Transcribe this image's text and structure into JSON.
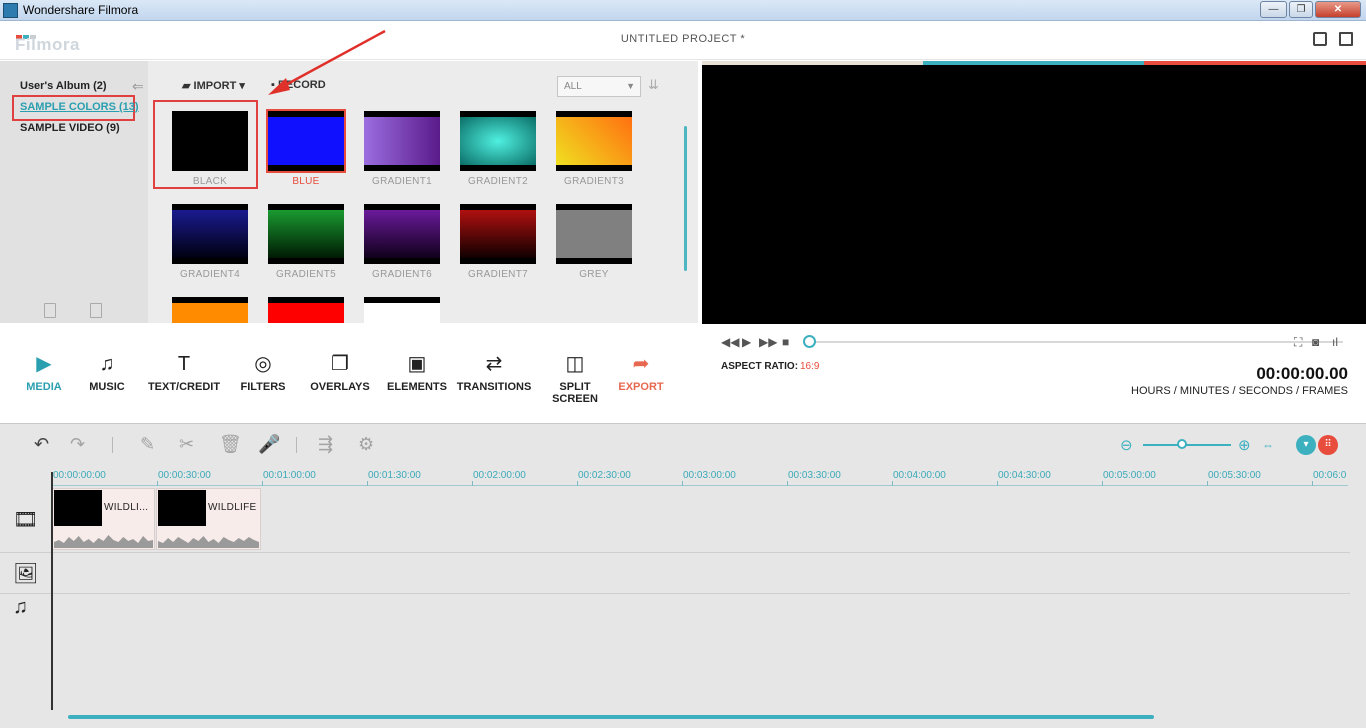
{
  "window": {
    "title": "Wondershare Filmora",
    "minimize": "—",
    "restore": "❐",
    "close": "✕"
  },
  "header": {
    "logo": "Filmora",
    "project_title": "UNTITLED PROJECT *",
    "logo_colors": [
      "#e74c3c",
      "#3db0c0",
      "#c9ced3"
    ]
  },
  "album": {
    "items": [
      {
        "label": "User's Album (2)"
      },
      {
        "label": "SAMPLE COLORS (13)"
      },
      {
        "label": "SAMPLE VIDEO (9)"
      }
    ],
    "back_icon": "left-arrow-icon"
  },
  "library": {
    "import_label": "IMPORT",
    "record_label": "RECORD",
    "filter_value": "ALL",
    "thumbs": [
      {
        "label": "BLACK",
        "color": "#000000"
      },
      {
        "label": "BLUE",
        "color": "#1010ff"
      },
      {
        "label": "GRADIENT1",
        "color": "linear-gradient(90deg,#9b6ee0,#5a1a8a)"
      },
      {
        "label": "GRADIENT2",
        "color": "radial-gradient(ellipse at center,#4ff0e0,#0a6d66)"
      },
      {
        "label": "GRADIENT3",
        "color": "linear-gradient(45deg,#f0e020,#ff7010)"
      },
      {
        "label": "GRADIENT4",
        "color": "linear-gradient(180deg,#1a1a90,#000010)"
      },
      {
        "label": "GRADIENT5",
        "color": "linear-gradient(180deg,#1a9a30,#001a04)"
      },
      {
        "label": "GRADIENT6",
        "color": "linear-gradient(180deg,#6a1a9a,#10001a)"
      },
      {
        "label": "GRADIENT7",
        "color": "linear-gradient(180deg,#b01010,#100000)"
      },
      {
        "label": "GREY",
        "color": "#808080"
      },
      {
        "label": "",
        "color": "#ff8c00"
      },
      {
        "label": "",
        "color": "#ff0000"
      },
      {
        "label": "",
        "color": "#ffffff"
      }
    ]
  },
  "preview": {
    "bar_colors": [
      "#e6e1d4",
      "#3db0c0",
      "#e74c3c"
    ],
    "aspect_label": "ASPECT RATIO:",
    "aspect_value": "16:9",
    "timecode": "00:00:00.00",
    "timecode_label": "HOURS / MINUTES / SECONDS / FRAMES"
  },
  "tabs": [
    {
      "label": "MEDIA",
      "icon": "▶"
    },
    {
      "label": "MUSIC",
      "icon": "♫"
    },
    {
      "label": "TEXT/CREDIT",
      "icon": "T"
    },
    {
      "label": "FILTERS",
      "icon": "◎"
    },
    {
      "label": "OVERLAYS",
      "icon": "❐"
    },
    {
      "label": "ELEMENTS",
      "icon": "▣"
    },
    {
      "label": "TRANSITIONS",
      "icon": "⇄"
    },
    {
      "label": "SPLIT SCREEN",
      "icon": "◫"
    },
    {
      "label": "EXPORT",
      "icon": "➦"
    }
  ],
  "timeline": {
    "ruler": [
      "00:00:00:00",
      "00:00:30:00",
      "00:01:00:00",
      "00:01:30:00",
      "00:02:00:00",
      "00:02:30:00",
      "00:03:00:00",
      "00:03:30:00",
      "00:04:00:00",
      "00:04:30:00",
      "00:05:00:00",
      "00:05:30:00",
      "00:06:0"
    ],
    "clips": [
      {
        "name": "WILDLI..."
      },
      {
        "name": "WILDLIFE"
      }
    ]
  }
}
